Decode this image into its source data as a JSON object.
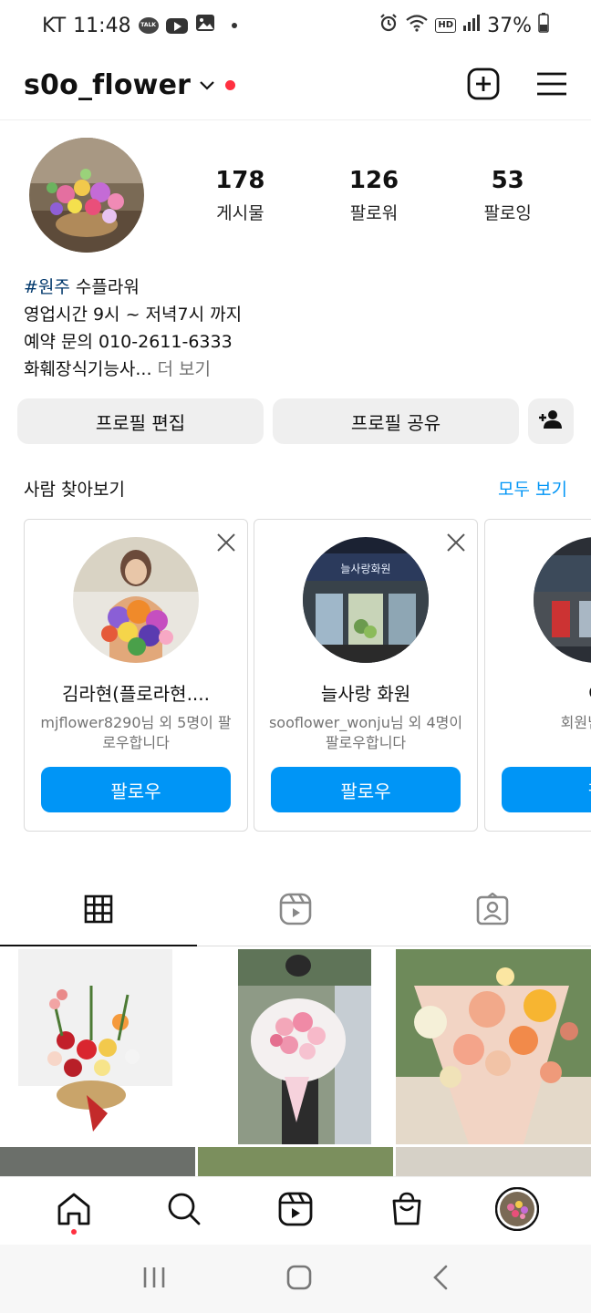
{
  "status_bar": {
    "carrier": "KT",
    "time": "11:48",
    "talk_badge": "TALK",
    "hd_badge": "HD",
    "battery": "37%"
  },
  "header": {
    "username": "s0o_flower"
  },
  "profile": {
    "stats": [
      {
        "value": "178",
        "label": "게시물"
      },
      {
        "value": "126",
        "label": "팔로워"
      },
      {
        "value": "53",
        "label": "팔로잉"
      }
    ],
    "bio": {
      "hashtag": "#원주",
      "line1_rest": " 수플라워",
      "line2": "영업시간 9시 ~ 저녁7시 까지",
      "line3": "예약 문의 010-2611-6333",
      "line4": "화훼장식기능사...",
      "more": " 더 보기"
    },
    "buttons": {
      "edit": "프로필 편집",
      "share": "프로필 공유"
    }
  },
  "discover": {
    "title": "사람 찾아보기",
    "see_all": "모두 보기",
    "cards": [
      {
        "name": "김라현(플로라현....",
        "subtitle": "mjflower8290님 외 5명이 팔로우합니다",
        "button": "팔로우"
      },
      {
        "name": "늘사랑 화원",
        "subtitle": "sooflower_wonju님 외 4명이 팔로우합니다",
        "button": "팔로우",
        "sign_text": "늘사랑화원"
      },
      {
        "name": "이",
        "subtitle": "회원님을 팔",
        "button": "팔"
      }
    ]
  },
  "colors": {
    "accent": "#0095f6",
    "notification": "#ff3040",
    "hashtag": "#00376b"
  }
}
